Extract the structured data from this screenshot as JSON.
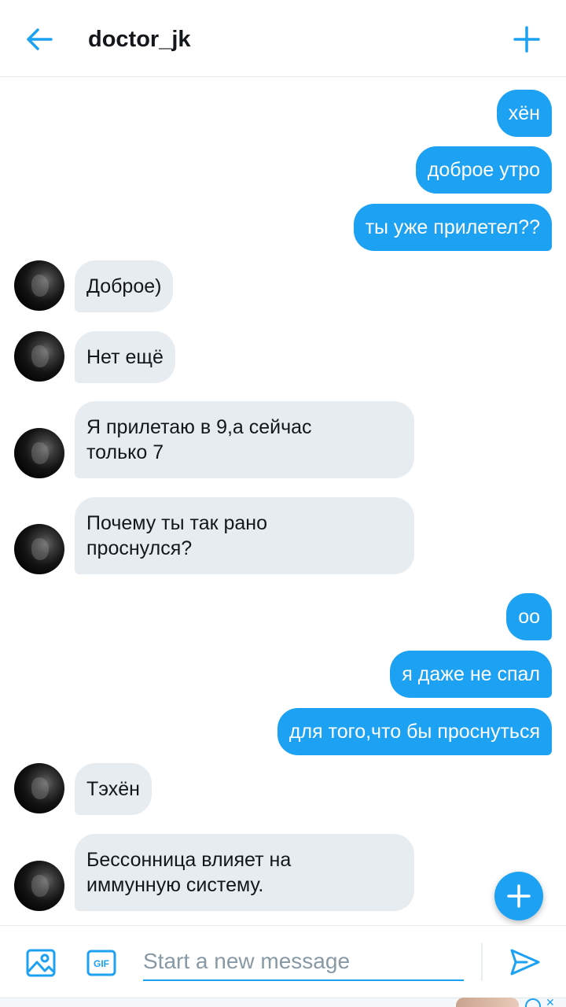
{
  "header": {
    "title": "doctor_jk",
    "back_icon": "arrow-left-icon",
    "add_icon": "plus-icon"
  },
  "messages": [
    {
      "dir": "out",
      "text": "хён"
    },
    {
      "dir": "out",
      "text": "доброе утро"
    },
    {
      "dir": "out",
      "text": "ты уже прилетел??"
    },
    {
      "dir": "in",
      "text": "Доброе)"
    },
    {
      "dir": "in",
      "text": "Нет ещё"
    },
    {
      "dir": "in",
      "text": "Я прилетаю в 9,а сейчас\nтолько 7"
    },
    {
      "dir": "in",
      "text": "Почему ты так рано\nпроснулся?"
    },
    {
      "dir": "out",
      "text": "оо"
    },
    {
      "dir": "out",
      "text": "я даже не спал"
    },
    {
      "dir": "out",
      "text": "для того,что бы проснуться"
    },
    {
      "dir": "in",
      "text": "Тэхён"
    },
    {
      "dir": "in",
      "text": "Бессонница влияет на\nиммунную систему."
    }
  ],
  "composer": {
    "placeholder": "Start a new message",
    "value": "",
    "media_icon": "image-icon",
    "gif_icon": "gif-icon",
    "gif_label": "GIF",
    "send_icon": "send-icon"
  },
  "fab_icon": "plus-icon",
  "colors": {
    "accent": "#1da1f2",
    "incoming_bubble": "#e6ecf0",
    "outgoing_text": "#ffffff"
  }
}
